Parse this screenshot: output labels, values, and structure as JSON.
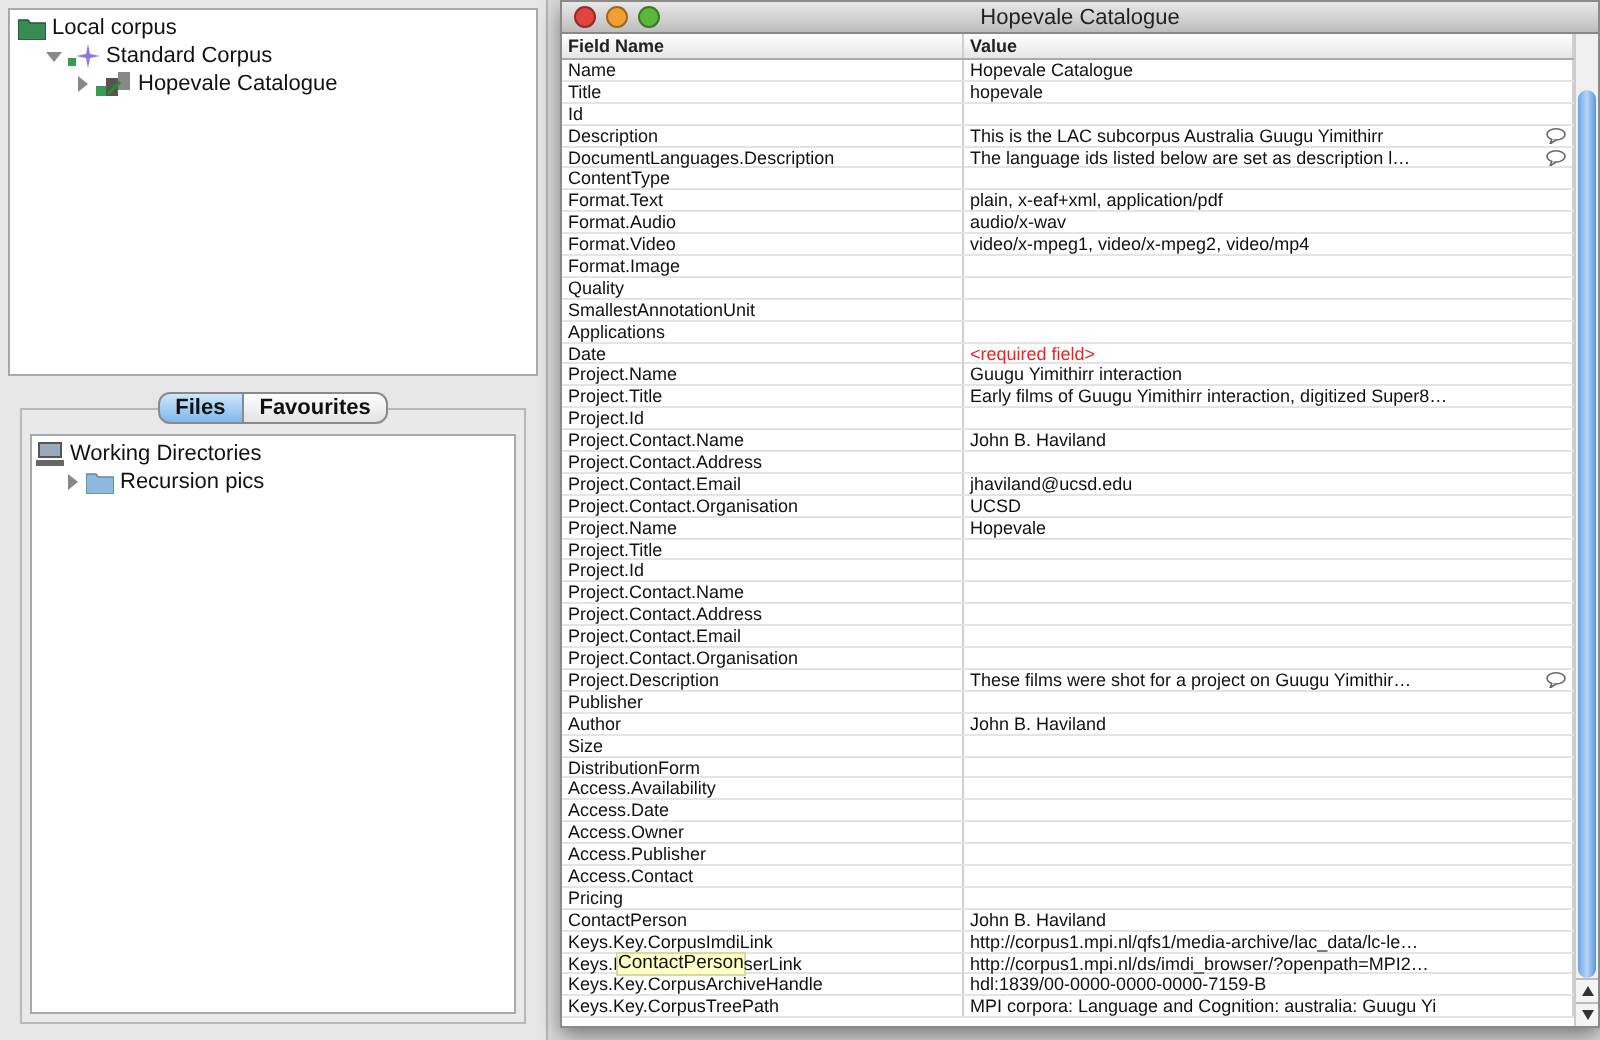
{
  "corpus_tree": [
    {
      "label": "Local corpus",
      "kind": "folder",
      "children": [
        {
          "label": "Standard Corpus",
          "kind": "corpus",
          "expanded": true,
          "children": [
            {
              "label": "Hopevale Catalogue",
              "kind": "catalogue",
              "expanded": false
            }
          ]
        }
      ]
    }
  ],
  "tabs": [
    {
      "label": "Files",
      "selected": true
    },
    {
      "label": "Favourites",
      "selected": false
    }
  ],
  "files_tree": [
    {
      "label": "Working Directories",
      "kind": "computer",
      "children": [
        {
          "label": "Recursion pics",
          "kind": "folder",
          "expanded": false
        }
      ]
    }
  ],
  "window": {
    "title": "Hopevale Catalogue",
    "columns": [
      "Field Name",
      "Value"
    ],
    "rows": [
      {
        "field": "Name",
        "value": "Hopevale Catalogue",
        "note": false
      },
      {
        "field": "Title",
        "value": "hopevale",
        "note": false
      },
      {
        "field": "Id",
        "note": false
      },
      {
        "field": "Description",
        "value": "This is the LAC subcorpus Australia Guugu Yimithirr",
        "note": true
      },
      {
        "field": "DocumentLanguages.Description",
        "value": "The language ids listed below are set as description l…",
        "note": true
      },
      {
        "field": "ContentType",
        "note": false
      },
      {
        "field": "Format.Text",
        "value": "plain, x-eaf+xml, application/pdf",
        "note": false
      },
      {
        "field": "Format.Audio",
        "value": "audio/x-wav",
        "note": false
      },
      {
        "field": "Format.Video",
        "value": "video/x-mpeg1, video/x-mpeg2, video/mp4",
        "note": false
      },
      {
        "field": "Format.Image",
        "note": false
      },
      {
        "field": "Quality",
        "note": false
      },
      {
        "field": "SmallestAnnotationUnit",
        "note": false
      },
      {
        "field": "Applications",
        "note": false
      },
      {
        "field": "Date",
        "value": "<required field>",
        "kind": "required",
        "note": false
      },
      {
        "field": "Project.Name",
        "value": "Guugu Yimithirr interaction",
        "note": false
      },
      {
        "field": "Project.Title",
        "value": "Early films of Guugu Yimithirr interaction, digitized Super8…",
        "note": false
      },
      {
        "field": "Project.Id",
        "note": false
      },
      {
        "field": "Project.Contact.Name",
        "value": "John B. Haviland",
        "note": false
      },
      {
        "field": "Project.Contact.Address",
        "note": false
      },
      {
        "field": "Project.Contact.Email",
        "value": "jhaviland@ucsd.edu",
        "note": false
      },
      {
        "field": "Project.Contact.Organisation",
        "value": "UCSD",
        "note": false
      },
      {
        "field": "Project.Name",
        "value": "Hopevale",
        "note": false
      },
      {
        "field": "Project.Title",
        "note": false
      },
      {
        "field": "Project.Id",
        "note": false
      },
      {
        "field": "Project.Contact.Name",
        "note": false
      },
      {
        "field": "Project.Contact.Address",
        "note": false
      },
      {
        "field": "Project.Contact.Email",
        "note": false
      },
      {
        "field": "Project.Contact.Organisation",
        "note": false
      },
      {
        "field": "Project.Description",
        "value": "These films were shot for a project on Guugu Yimithir…",
        "note": true
      },
      {
        "field": "Publisher",
        "note": false
      },
      {
        "field": "Author",
        "value": "John B. Haviland",
        "note": false
      },
      {
        "field": "Size",
        "note": false
      },
      {
        "field": "DistributionForm",
        "note": false
      },
      {
        "field": "Access.Availability",
        "note": false
      },
      {
        "field": "Access.Date",
        "note": false
      },
      {
        "field": "Access.Owner",
        "note": false
      },
      {
        "field": "Access.Publisher",
        "note": false
      },
      {
        "field": "Access.Contact",
        "note": false
      },
      {
        "field": "Pricing",
        "note": false
      },
      {
        "field": "ContactPerson",
        "value": "John B. Haviland",
        "note": false
      },
      {
        "field": "Keys.Key.CorpusImdiLink",
        "value": "http://corpus1.mpi.nl/qfs1/media-archive/lac_data/lc-le…",
        "note": false
      },
      {
        "field_start": "Keys.I",
        "tooltip": "ContactPerson",
        "field_end": "serLink",
        "value": "http://corpus1.mpi.nl/ds/imdi_browser/?openpath=MPI2…",
        "note": false
      },
      {
        "field": "Keys.Key.CorpusArchiveHandle",
        "value": "hdl:1839/00-0000-0000-0000-7159-B",
        "note": false
      },
      {
        "field": "Keys.Key.CorpusTreePath",
        "value": "MPI corpora: Language and Cognition: australia: Guugu Yi",
        "note": false
      }
    ]
  }
}
